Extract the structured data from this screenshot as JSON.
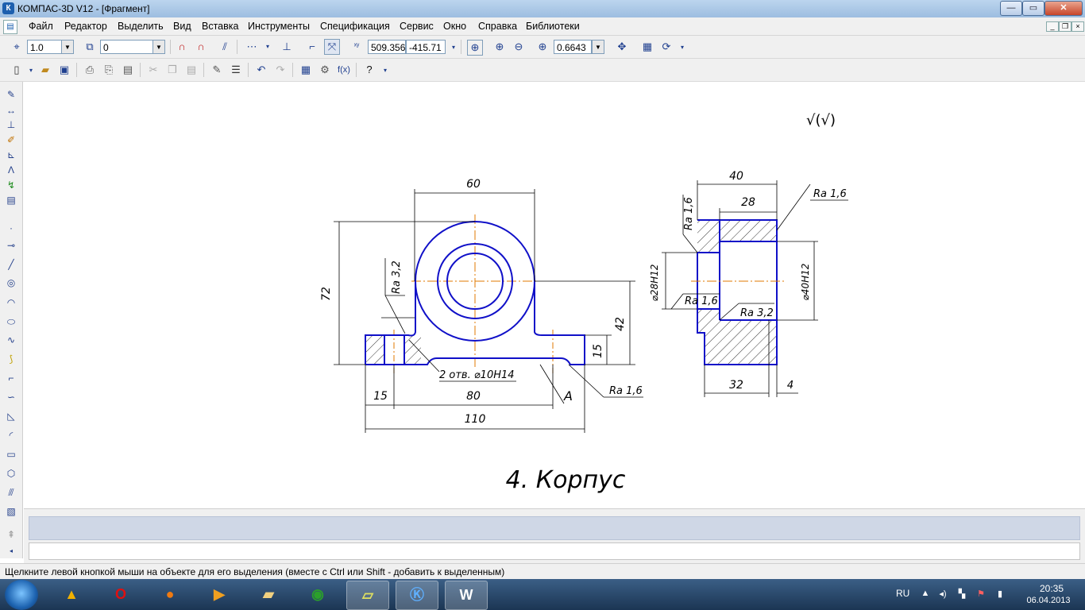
{
  "window": {
    "title": "КОМПАС-3D V12 - [Фрагмент]",
    "app_icon": "К",
    "controls": {
      "minimize": "—",
      "maximize": "▭",
      "close": "✕"
    }
  },
  "menu": [
    "Файл",
    "Редактор",
    "Выделить",
    "Вид",
    "Вставка",
    "Инструменты",
    "Спецификация",
    "Сервис",
    "Окно",
    "Справка",
    "Библиотеки"
  ],
  "toolbar1": {
    "step": "1.0",
    "layer": "0",
    "coord_x": "509.356",
    "coord_y": "-415.71",
    "zoom": "0.6643"
  },
  "drawing": {
    "dimensions": {
      "top_width": "60",
      "height": "72",
      "center_height": "42",
      "base_height": "15",
      "hole_offset": "15",
      "hole_spacing": "80",
      "total_width": "110",
      "side_width": "40",
      "side_inner": "28",
      "side_bottom": "32",
      "side_small": "4",
      "diam_inner": "⌀28H12",
      "diam_outer": "⌀40H12"
    },
    "callouts": {
      "holes": "2 отв. ⌀10H14",
      "view_label": "A",
      "ra_32_a": "Ra 3,2",
      "ra_16_a": "Ra 1,6",
      "ra_16_b": "Ra 1,6",
      "ra_16_c": "Ra 1,6",
      "ra_16_d": "Ra 1,6",
      "ra_32_b": "Ra 3,2",
      "corner_mark": "√(√)"
    },
    "caption": "4. Корпус"
  },
  "status_text": "Щелкните левой кнопкой мыши на объекте для его выделения (вместе с Ctrl или Shift - добавить к выделенным)",
  "taskbar": {
    "language": "RU",
    "time": "20:35",
    "date": "06.04.2013"
  }
}
